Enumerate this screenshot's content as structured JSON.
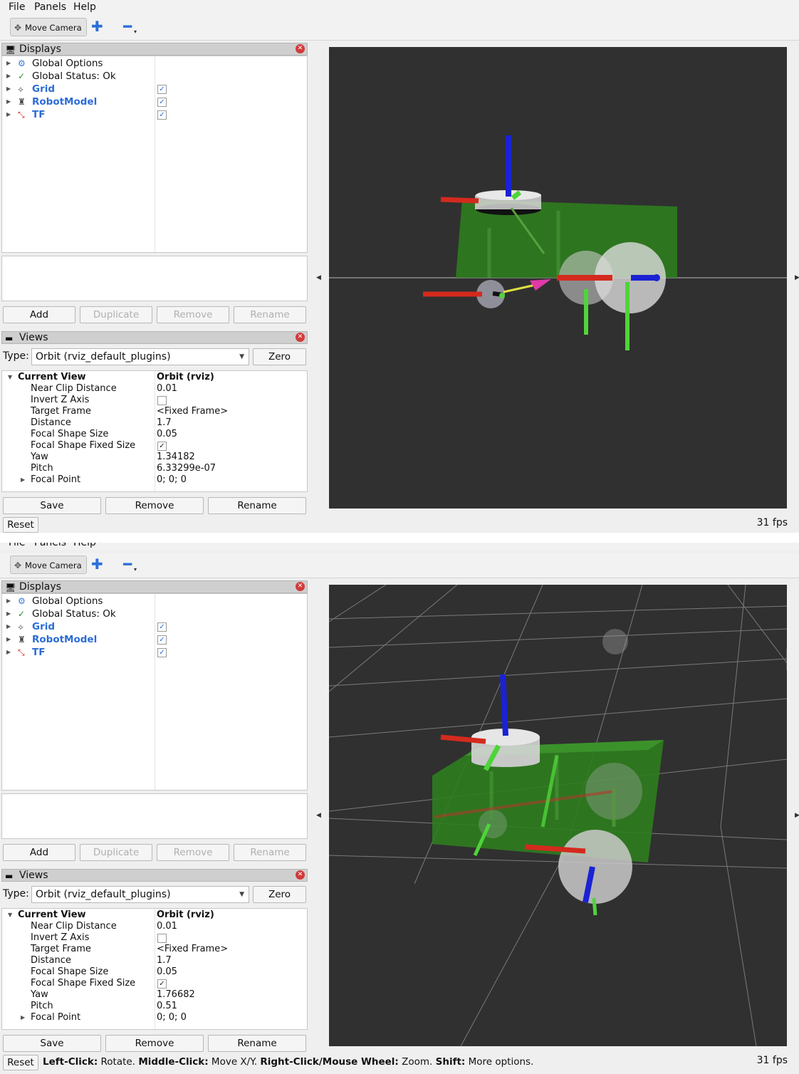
{
  "menu": {
    "file": "File",
    "panels": "Panels",
    "help": "Help",
    "file_top2": "File",
    "panels_top2": "Panels",
    "help_top2": "Help"
  },
  "toolbar": {
    "move_camera": "Move Camera"
  },
  "displays": {
    "title": "Displays",
    "items": [
      {
        "label": "Global Options",
        "icon": "gear-icon",
        "checked": null
      },
      {
        "label": "Global Status: Ok",
        "icon": "checkmark-icon",
        "checked": null
      },
      {
        "label": "Grid",
        "icon": "grid-icon",
        "checked": true
      },
      {
        "label": "RobotModel",
        "icon": "robot-icon",
        "checked": true
      },
      {
        "label": "TF",
        "icon": "axes-icon",
        "checked": true
      }
    ],
    "buttons": {
      "add": "Add",
      "duplicate": "Duplicate",
      "remove": "Remove",
      "rename": "Rename"
    }
  },
  "views": {
    "title": "Views",
    "type_label": "Type:",
    "type_value": "Orbit (rviz_default_plugins)",
    "zero": "Zero",
    "buttons": {
      "save": "Save",
      "remove": "Remove",
      "rename": "Rename"
    }
  },
  "view1": {
    "current_view": "Current View",
    "current_view_value": "Orbit (rviz)",
    "props": {
      "near_clip": {
        "k": "Near Clip Distance",
        "v": "0.01"
      },
      "invert_z": {
        "k": "Invert Z Axis",
        "checked": false
      },
      "target_frame": {
        "k": "Target Frame",
        "v": "<Fixed Frame>"
      },
      "distance": {
        "k": "Distance",
        "v": "1.7"
      },
      "focal_size": {
        "k": "Focal Shape Size",
        "v": "0.05"
      },
      "focal_fixed": {
        "k": "Focal Shape Fixed Size",
        "checked": true
      },
      "yaw": {
        "k": "Yaw",
        "v": "1.34182"
      },
      "pitch": {
        "k": "Pitch",
        "v": "6.33299e-07"
      },
      "focal_point": {
        "k": "Focal Point",
        "v": "0; 0; 0"
      }
    }
  },
  "view2": {
    "current_view": "Current View",
    "current_view_value": "Orbit (rviz)",
    "props": {
      "near_clip": {
        "k": "Near Clip Distance",
        "v": "0.01"
      },
      "invert_z": {
        "k": "Invert Z Axis",
        "checked": false
      },
      "target_frame": {
        "k": "Target Frame",
        "v": "<Fixed Frame>"
      },
      "distance": {
        "k": "Distance",
        "v": "1.7"
      },
      "focal_size": {
        "k": "Focal Shape Size",
        "v": "0.05"
      },
      "focal_fixed": {
        "k": "Focal Shape Fixed Size",
        "checked": true
      },
      "yaw": {
        "k": "Yaw",
        "v": "1.76682"
      },
      "pitch": {
        "k": "Pitch",
        "v": "0.51"
      },
      "focal_point": {
        "k": "Focal Point",
        "v": "0; 0; 0"
      }
    }
  },
  "bottom": {
    "reset": "Reset",
    "fps": "31 fps",
    "status": {
      "left_key": "Left-Click:",
      "left_val": " Rotate. ",
      "middle_key": "Middle-Click:",
      "middle_val": " Move X/Y. ",
      "right_key": "Right-Click/Mouse Wheel:",
      "right_val": " Zoom. ",
      "shift_key": "Shift:",
      "shift_val": " More options."
    }
  },
  "colors": {
    "viewport_bg": "#303030",
    "robot_body": "#2e7d1e",
    "axis_x": "#d42a1e",
    "axis_y": "#4fd43a",
    "axis_z": "#1e2ed4",
    "link_label_blue": "#2b6cd6"
  }
}
